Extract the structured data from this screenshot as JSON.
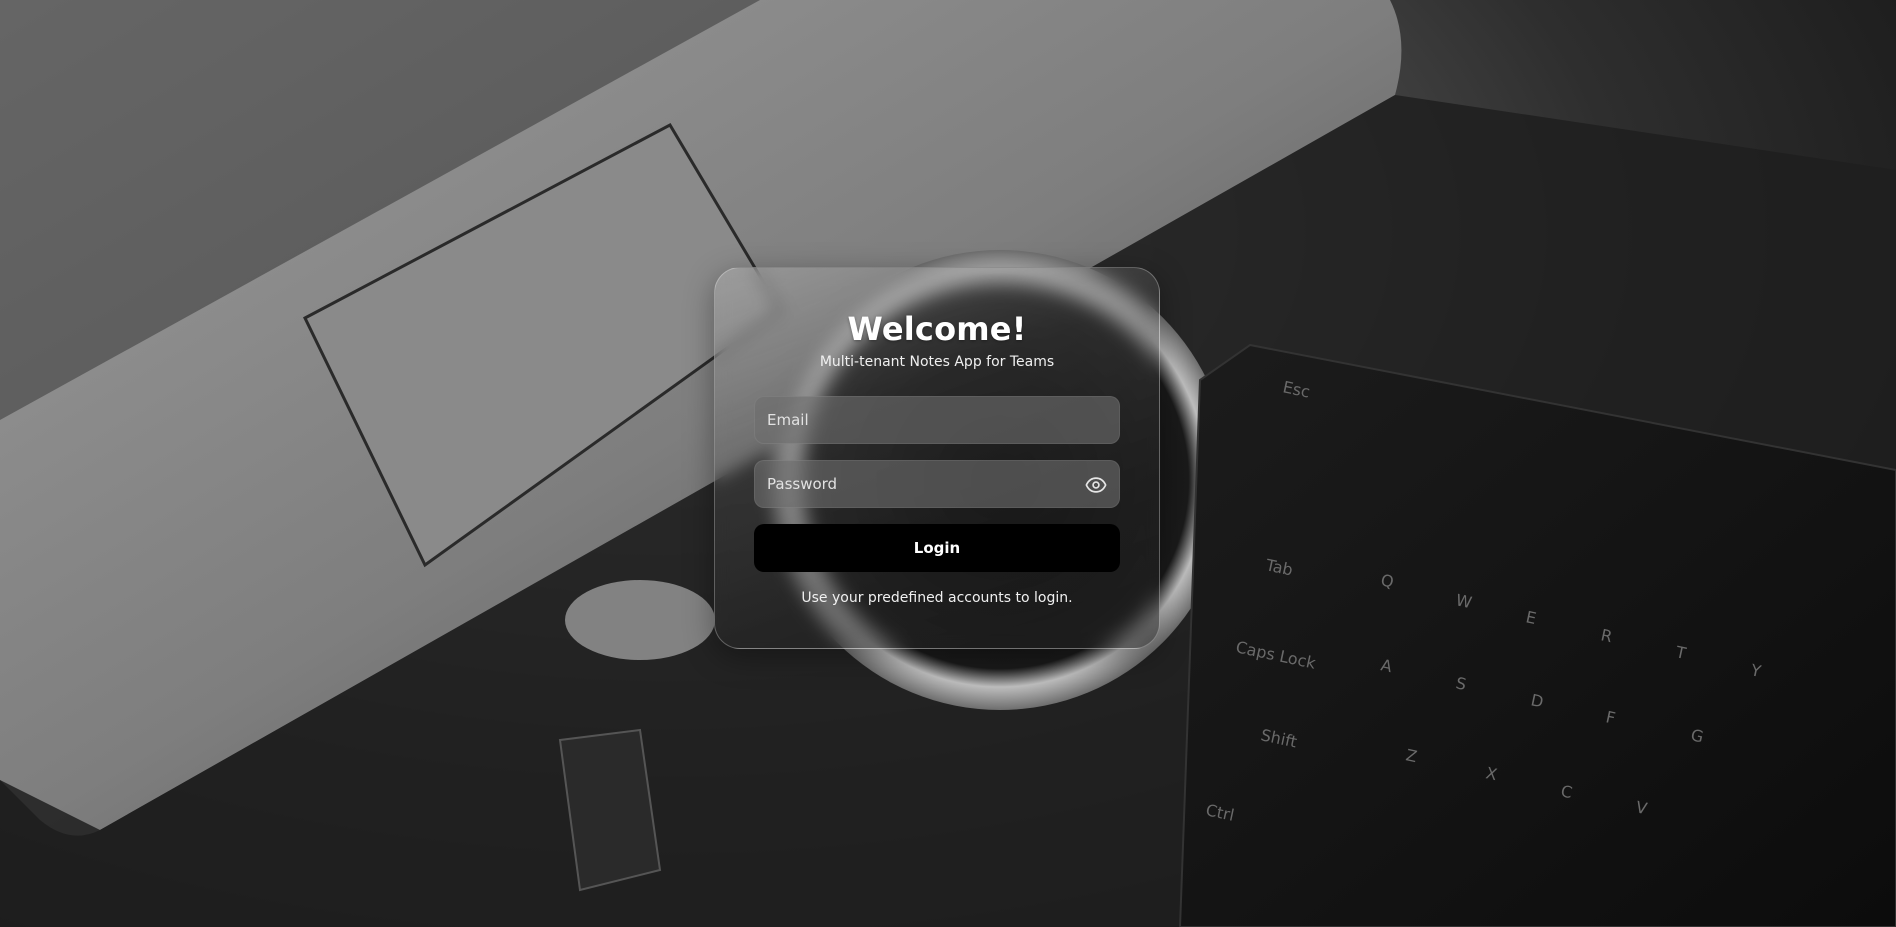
{
  "login_card": {
    "title": "Welcome!",
    "subtitle": "Multi-tenant Notes App for Teams",
    "email_placeholder": "Email",
    "password_placeholder": "Password",
    "login_label": "Login",
    "hint": "Use your predefined accounts to login."
  },
  "icons": {
    "password_toggle": "eye-icon"
  },
  "colors": {
    "button_background": "#000000",
    "button_text": "#ffffff",
    "input_background": "#6e6e6e",
    "text": "#ffffff"
  }
}
